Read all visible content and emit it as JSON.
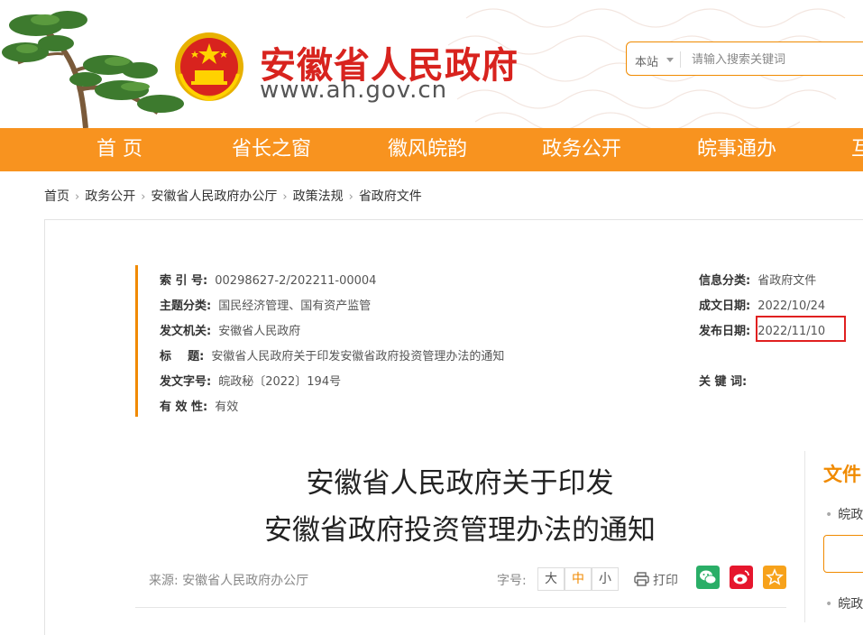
{
  "site": {
    "title": "安徽省人民政府",
    "url": "www.ah.gov.cn"
  },
  "search": {
    "scope": "本站",
    "placeholder": "请输入搜索关键词"
  },
  "nav": {
    "items": [
      "首 页",
      "省长之窗",
      "徽风皖韵",
      "政务公开",
      "皖事通办",
      "互"
    ]
  },
  "breadcrumb": [
    "首页",
    "政务公开",
    "安徽省人民政府办公厅",
    "政策法规",
    "省政府文件"
  ],
  "meta": {
    "index_label": "索 引 号:",
    "index_value": "00298627-2/202211-00004",
    "category_label": "主题分类:",
    "category_value": "国民经济管理、国有资产监管",
    "issuer_label": "发文机关:",
    "issuer_value": "安徽省人民政府",
    "title_label": "标    题:",
    "title_value": "安徽省人民政府关于印发安徽省政府投资管理办法的通知",
    "docno_label": "发文字号:",
    "docno_value": "皖政秘〔2022〕194号",
    "validity_label": "有 效 性:",
    "validity_value": "有效",
    "infotype_label": "信息分类:",
    "infotype_value": "省政府文件",
    "created_label": "成文日期:",
    "created_value": "2022/10/24",
    "published_label": "发布日期:",
    "published_value": "2022/11/10",
    "keywords_label": "关 键 词:",
    "keywords_value": ""
  },
  "document": {
    "title_line1": "安徽省人民政府关于印发",
    "title_line2": "安徽省政府投资管理办法的通知",
    "source": "来源: 安徽省人民政府办公厅",
    "font_size_label": "字号:",
    "font_sizes": [
      "大",
      "中",
      "小"
    ],
    "print_label": "打印"
  },
  "sidebar": {
    "title": "文件",
    "items": [
      "皖政",
      "皖政"
    ]
  },
  "colors": {
    "brand_red": "#d8231e",
    "nav_orange": "#f8931f",
    "accent_orange": "#f08a00",
    "highlight_red": "#e02020",
    "wechat_green": "#2aae67",
    "weibo_red": "#e6162d",
    "favorite_orange": "#f7a21b"
  },
  "icons": [
    "national-emblem-icon",
    "pine-tree-icon",
    "print-icon",
    "wechat-icon",
    "weibo-icon",
    "favorite-icon"
  ]
}
